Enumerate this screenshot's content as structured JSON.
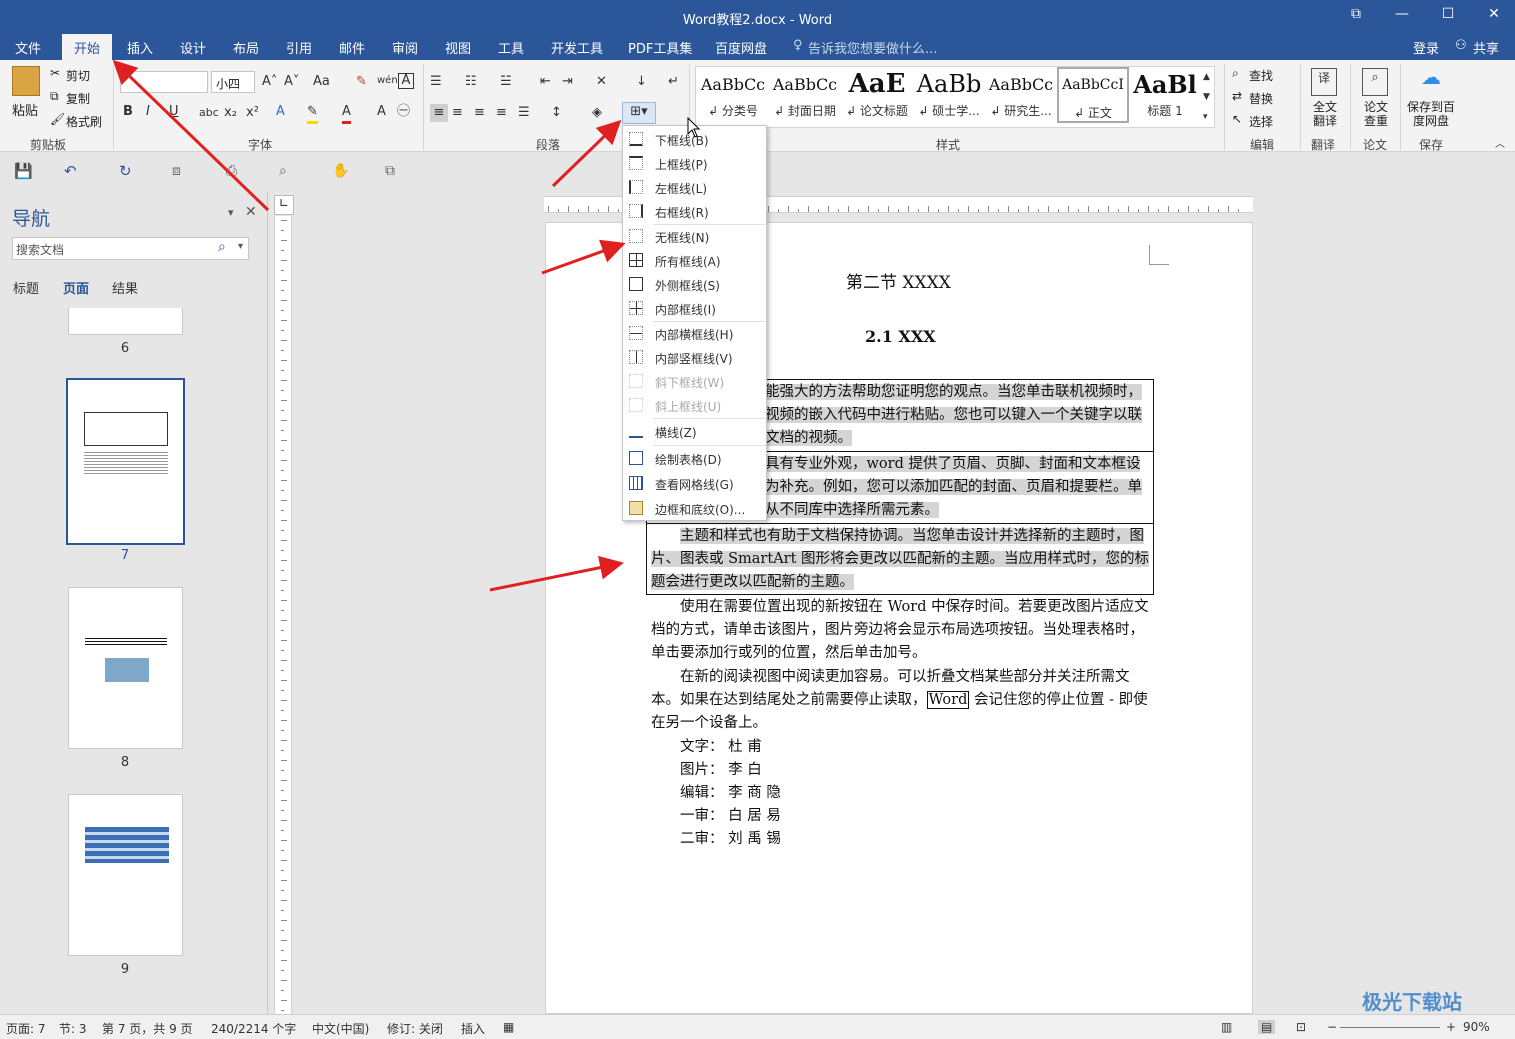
{
  "window": {
    "title": "Word教程2.docx - Word",
    "controls": [
      "⧉",
      "—",
      "☐",
      "✕"
    ]
  },
  "menu_tabs": [
    "文件",
    "开始",
    "插入",
    "设计",
    "布局",
    "引用",
    "邮件",
    "审阅",
    "视图",
    "工具",
    "开发工具",
    "PDF工具集",
    "百度网盘"
  ],
  "tell_me": "告诉我您想要做什么...",
  "account": {
    "login": "登录",
    "share": "共享"
  },
  "ribbon": {
    "clipboard": {
      "paste": "粘贴",
      "cut": "剪切",
      "copy": "复制",
      "format_painter": "格式刷",
      "label": "剪贴板"
    },
    "font": {
      "font_name": "",
      "font_size": "小四",
      "change_case": "Aa",
      "label": "字体"
    },
    "paragraph": {
      "label": "段落"
    },
    "styles": {
      "items": [
        {
          "sample": "AaBbCc",
          "name": "↲ 分类号"
        },
        {
          "sample": "AaBbCc",
          "name": "↲ 封面日期"
        },
        {
          "sample": "AaE",
          "name": "↲ 论文标题"
        },
        {
          "sample": "AaBb",
          "name": "↲ 硕士学..."
        },
        {
          "sample": "AaBbCc",
          "name": "↲ 研究生..."
        },
        {
          "sample": "AaBbCcI",
          "name": "↲ 正文"
        },
        {
          "sample": "AaBl",
          "name": "标题 1"
        }
      ],
      "label": "样式"
    },
    "editing": {
      "find": "查找",
      "replace": "替换",
      "select": "选择",
      "label": "编辑"
    },
    "translate": {
      "button": "全文翻译",
      "label": "翻译"
    },
    "paper": {
      "button": "论文查重",
      "label": "论文"
    },
    "save": {
      "button": "保存到百度网盘",
      "label": "保存"
    }
  },
  "nav_pane": {
    "title": "导航",
    "search_placeholder": "搜索文档",
    "tabs": [
      "标题",
      "页面",
      "结果"
    ],
    "pages": [
      "6",
      "7",
      "8",
      "9"
    ]
  },
  "border_menu": [
    {
      "label": "下框线(B)",
      "disabled": false
    },
    {
      "label": "上框线(P)",
      "disabled": false
    },
    {
      "label": "左框线(L)",
      "disabled": false
    },
    {
      "label": "右框线(R)",
      "disabled": false
    },
    {
      "label": "无框线(N)",
      "disabled": false
    },
    {
      "label": "所有框线(A)",
      "disabled": false
    },
    {
      "label": "外侧框线(S)",
      "disabled": false
    },
    {
      "label": "内部框线(I)",
      "disabled": false
    },
    {
      "label": "内部横框线(H)",
      "disabled": false
    },
    {
      "label": "内部竖框线(V)",
      "disabled": false
    },
    {
      "label": "斜下框线(W)",
      "disabled": true
    },
    {
      "label": "斜上框线(U)",
      "disabled": true
    },
    {
      "label": "横线(Z)",
      "disabled": false
    },
    {
      "label": "绘制表格(D)",
      "disabled": false
    },
    {
      "label": "查看网格线(G)",
      "disabled": false
    },
    {
      "label": "边框和底纹(O)...",
      "disabled": false
    }
  ],
  "document": {
    "section_title": "第二节  XXXX",
    "heading": "2.1 XXX",
    "cell1": [
      "能强大的方法帮助您证明您的观点。当您单击联机视频时，",
      "视频的嵌入代码中进行粘贴。您也可以键入一个关键字以联",
      "文档的视频。"
    ],
    "cell2": [
      "具有专业外观，word 提供了页眉、页脚、封面和文本框设",
      "为补充。例如，您可以添加匹配的封面、页眉和提要栏。单",
      "从不同库中选择所需元素。"
    ],
    "cell3": [
      "主题和样式也有助于文档保持协调。当您单击设计并选择新的主题时，图",
      "片、图表或 SmartArt 图形将会更改以匹配新的主题。当应用样式时，您的标",
      "题会进行更改以匹配新的主题。"
    ],
    "para1": [
      "使用在需要位置出现的新按钮在 Word 中保存时间。若要更改图片适应文",
      "档的方式，请单击该图片，图片旁边将会显示布局选项按钮。当处理表格时，",
      "单击要添加行或列的位置，然后单击加号。"
    ],
    "para2_l1": "在新的阅读视图中阅读更加容易。可以折叠文档某些部分并关注所需文",
    "para2_l2a": "本。如果在达到结尾处之前需要停止读取，",
    "para2_word": "Word",
    "para2_l2b": " 会记住您的停止位置 - 即使",
    "para2_l3": "在另一个设备上。",
    "credits": [
      "文字：  杜      甫",
      "图片：  李      白",
      "编辑：  李  商  隐",
      "一审：  白  居  易",
      "二审：  刘  禹  锡"
    ]
  },
  "status_bar": {
    "page": "页面: 7",
    "section": "节: 3",
    "page_of": "第 7 页，共 9 页",
    "words": "240/2214 个字",
    "language": "中文(中国)",
    "track": "修订: 关闭",
    "insert": "插入",
    "zoom": "90%"
  },
  "watermark": "极光下载站",
  "colors": {
    "word_blue": "#2b579a",
    "arrow_red": "#e02020",
    "highlight": "#d5d5d5"
  }
}
